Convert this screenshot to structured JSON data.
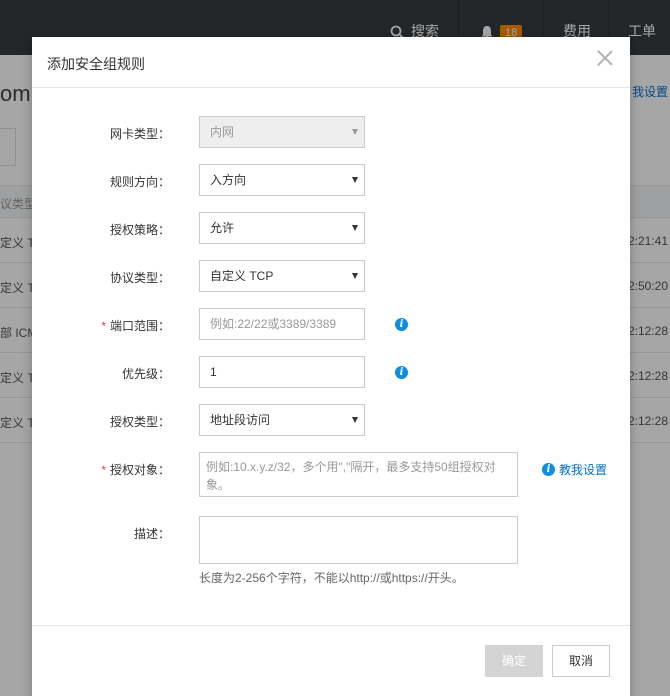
{
  "topbar": {
    "search_label": "搜索",
    "notification_count": "18",
    "fee_label": "费用",
    "ticket_label": "工单"
  },
  "background": {
    "title_fragment": "om",
    "link_fragment": "我设置",
    "header_fragment": "议类型",
    "rows": [
      {
        "col1": "定义 TC",
        "col2": "2:21:41"
      },
      {
        "col1": "定义 TC",
        "col2": "2:50:20"
      },
      {
        "col1": "部 ICMI",
        "col2": "2:12:28"
      },
      {
        "col1": "定义 TC",
        "col2": "2:12:28"
      },
      {
        "col1": "定义 TC",
        "col2": "2:12:28"
      }
    ]
  },
  "dialog": {
    "title": "添加安全组规则",
    "nic_type": {
      "label": "网卡类型：",
      "value": "内网"
    },
    "direction": {
      "label": "规则方向：",
      "value": "入方向"
    },
    "policy": {
      "label": "授权策略：",
      "value": "允许"
    },
    "protocol": {
      "label": "协议类型：",
      "value": "自定义 TCP"
    },
    "port_range": {
      "required_mark": "*",
      "label": "端口范围：",
      "placeholder": "例如:22/22或3389/3389"
    },
    "priority": {
      "label": "优先级：",
      "value": "1"
    },
    "auth_type": {
      "label": "授权类型：",
      "value": "地址段访问"
    },
    "auth_object": {
      "required_mark": "*",
      "label": "授权对象：",
      "placeholder": "例如:10.x.y.z/32，多个用\",\"隔开，最多支持50组授权对象。",
      "help_link": "教我设置"
    },
    "description": {
      "label": "描述：",
      "value": "",
      "hint": "长度为2-256个字符，不能以http://或https://开头。"
    },
    "ok_label": "确定",
    "cancel_label": "取消"
  }
}
